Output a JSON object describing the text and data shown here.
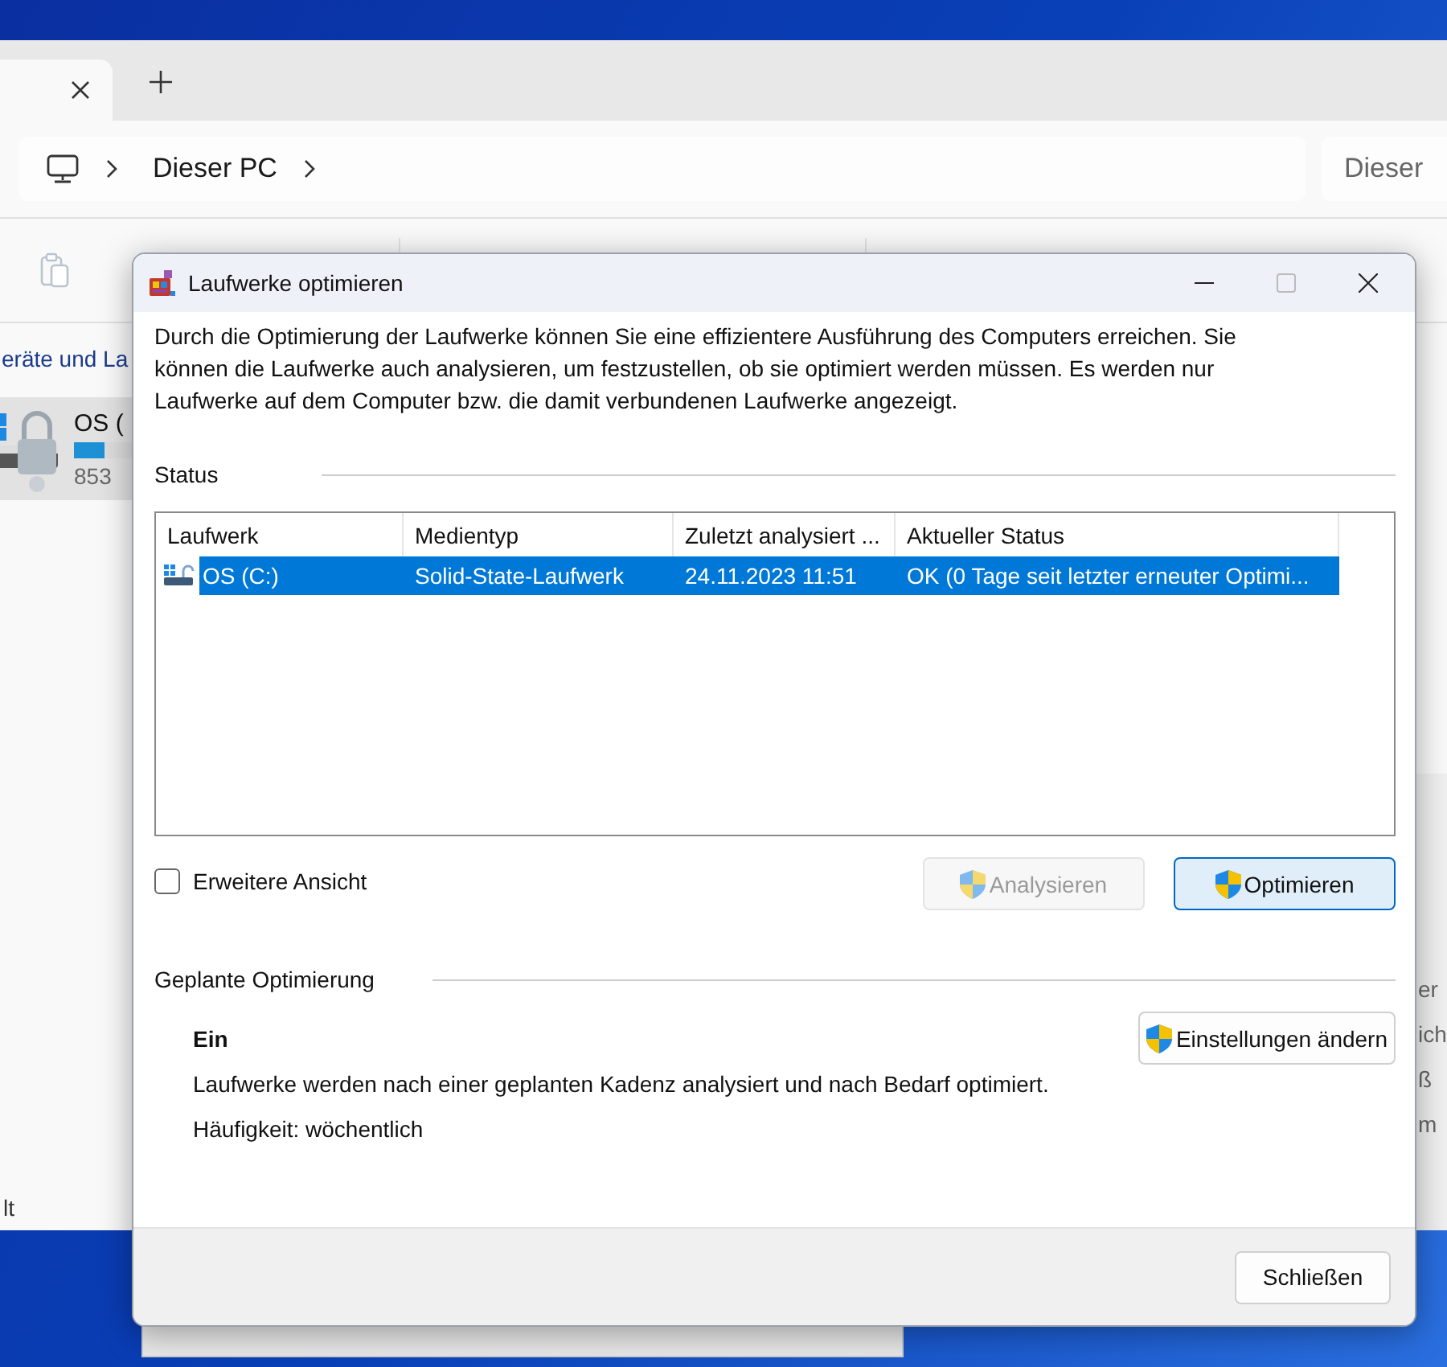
{
  "explorer": {
    "tab": {
      "selected": true
    },
    "address": {
      "crumbs": [
        "Dieser PC"
      ]
    },
    "search": {
      "placeholder": "Dieser"
    },
    "sidebar_heading": "eräte und La",
    "drive": {
      "name": "OS (",
      "size": "853",
      "level": 0.1,
      "selected": true
    },
    "footer_text": "lt",
    "details": [
      "er",
      "ich",
      "ß",
      "m"
    ]
  },
  "dialog": {
    "title": "Laufwerke optimieren",
    "description": "Durch die Optimierung der Laufwerke können Sie eine effizientere Ausführung des Computers erreichen. Sie können die Laufwerke auch analysieren, um festzustellen, ob sie optimiert werden müssen. Es werden nur Laufwerke auf dem Computer bzw. die damit verbundenen Laufwerke angezeigt.",
    "status_heading": "Status",
    "table": {
      "columns": [
        "Laufwerk",
        "Medientyp",
        "Zuletzt analysiert ...",
        "Aktueller Status"
      ],
      "rows": [
        {
          "cells": [
            "OS (C:)",
            "Solid-State-Laufwerk",
            "24.11.2023 11:51",
            "OK (0 Tage seit letzter erneuter Optimi..."
          ],
          "selected": true
        }
      ]
    },
    "advanced_view": {
      "label": "Erweitere Ansicht",
      "checked": false
    },
    "actions": [
      {
        "label": "Analysieren",
        "disabled": true,
        "default": false
      },
      {
        "label": "Optimieren",
        "disabled": false,
        "default": true
      }
    ],
    "schedule": {
      "heading": "Geplante Optimierung",
      "state": "Ein",
      "description": "Laufwerke werden nach einer geplanten Kadenz analysiert und nach Bedarf optimiert.",
      "frequency": "Häufigkeit: wöchentlich",
      "button": "Einstellungen ändern"
    },
    "close_button": "Schließen"
  }
}
